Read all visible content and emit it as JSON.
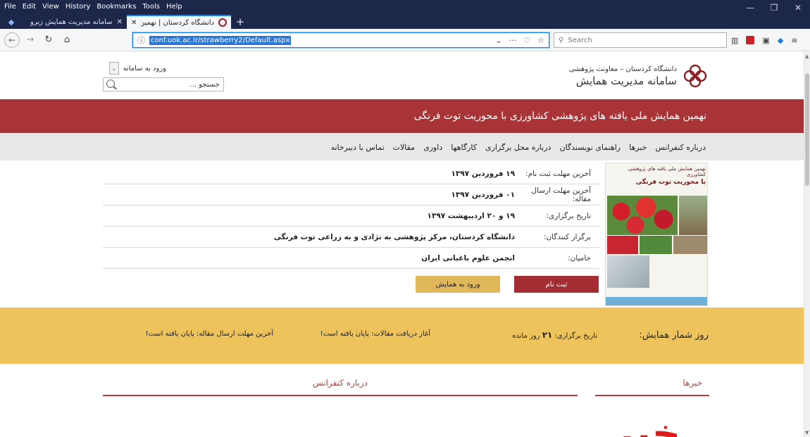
{
  "browser": {
    "menu": [
      "File",
      "Edit",
      "View",
      "History",
      "Bookmarks",
      "Tools",
      "Help"
    ],
    "tabs": [
      {
        "title": "سامانه مدیریت همایش زیرو",
        "active": false
      },
      {
        "title": "دانشگاه کردستان | نهمین همایش",
        "active": true
      }
    ],
    "new_tab": "+",
    "url": "conf.uok.ac.ir/strawberry2/Default.aspx",
    "search_placeholder": "Search",
    "accent": "#0a84ff"
  },
  "header": {
    "logo_line1": "دانشگاه کردستان – معاونت پژوهشی",
    "logo_line2": "سامانه مدیریت همایش",
    "login_label": "ورود به سامانه",
    "search_placeholder": "جستجو ...",
    "brand_color": "#a83438"
  },
  "banner": {
    "title": "نهمین همایش ملی یافته های پژوهشی کشاورزی با محوریت توت فرنگی"
  },
  "nav": {
    "items": [
      "درباره کنفرانس",
      "خبرها",
      "راهنمای نویسندگان",
      "درباره محل برگزاری",
      "کارگاهها",
      "داوری",
      "مقالات",
      "تماس با دبیرخانه"
    ]
  },
  "poster": {
    "title_line1": "نهمین همایش ملی یافته های پژوهشی کشاورزی",
    "title_line2": "با محوریت توت فرنگی"
  },
  "info": {
    "rows": [
      {
        "label": "آخرین مهلت ثبت نام:",
        "value": "۱۹ فروردین ۱۳۹۷"
      },
      {
        "label": "آخرین مهلت ارسال مقاله:",
        "value": "۰۱ فروردین ۱۳۹۷"
      },
      {
        "label": "تاریخ برگزاری:",
        "value": "۱۹ و ۲۰ اردیبهشت ۱۳۹۷"
      },
      {
        "label": "برگزار کنندگان:",
        "value": "دانشگاه کردستان، مرکز پژوهشی به نژادی و به زراعی توت فرنگی"
      },
      {
        "label": "حامیان:",
        "value": "انجمن علوم باغبانی ایران"
      }
    ],
    "register_label": "ثبت نام",
    "enter_label": "ورود به همایش"
  },
  "countdown": {
    "title": "روز شمار همایش:",
    "item1_prefix": "تاریخ برگزاری:",
    "item1_value": "۲۱",
    "item1_suffix": "روز مانده",
    "item2": "آغاز دریافت مقالات: پایان یافته است!",
    "item3": "آخرین مهلت ارسال مقاله: پایان یافته است!",
    "bg_color": "#eec35b"
  },
  "sections": {
    "about_title": "درباره کنفرانس",
    "news_title": "خبرها",
    "news_image_text": "خبر"
  }
}
